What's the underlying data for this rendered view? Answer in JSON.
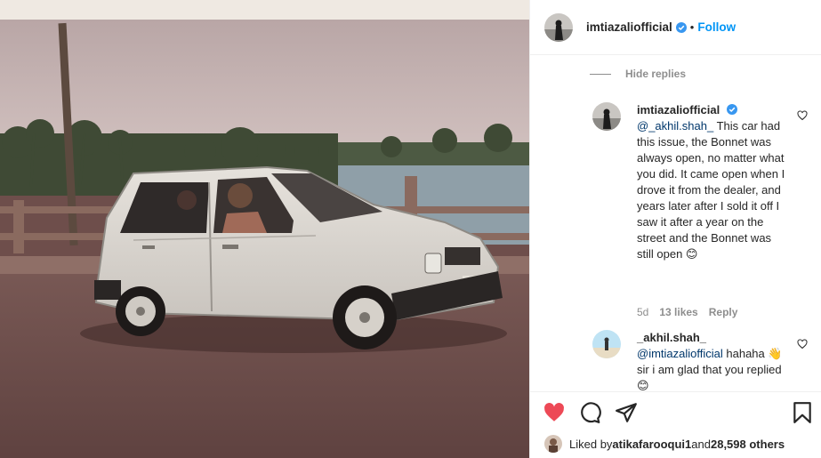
{
  "post": {
    "username": "imtiazaliofficial",
    "follow_label": "Follow",
    "separator": "•"
  },
  "thread": {
    "hide_replies_label": "Hide replies",
    "comments": [
      {
        "username": "imtiazaliofficial",
        "mention": "@_akhil.shah_",
        "text": " This car had this issue, the Bonnet was always open, no matter what you did. It came open when I drove it from the dealer, and years later after I sold it off I saw it after a year on the street and the Bonnet was still open ",
        "emoji": "😊",
        "age": "5d",
        "likes": "13 likes",
        "reply_label": "Reply"
      },
      {
        "username": "_akhil.shah_",
        "mention": "@imtiazaliofficial",
        "text": " hahaha ",
        "emoji": "👋",
        "text2": "sir i am glad that you replied ",
        "emoji2": "😊"
      }
    ]
  },
  "likes": {
    "prefix": "Liked by ",
    "user": "atikafarooqui1",
    "middle": " and ",
    "count": "28,598 others"
  },
  "icons": {
    "like": "heart-icon",
    "comment": "comment-bubble-icon",
    "share": "paper-plane-icon",
    "save": "bookmark-icon"
  },
  "colors": {
    "like_red": "#ed4956",
    "follow_blue": "#0095f6",
    "verified_blue": "#3897f0",
    "mention_blue": "#00376b"
  }
}
